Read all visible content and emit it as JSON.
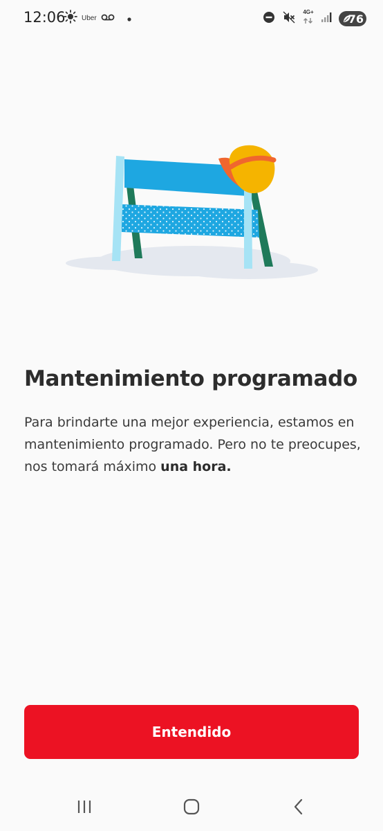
{
  "status_bar": {
    "time": "12:06",
    "uber_label": "Uber",
    "network_label": "4G+",
    "battery_level": "76",
    "icons": [
      "brightness-icon",
      "voicemail-icon",
      "dot-icon",
      "do-not-disturb-icon",
      "mute-icon",
      "signal-icon",
      "battery-icon"
    ]
  },
  "illustration": {
    "name": "barrier-with-hard-hat",
    "colors": {
      "board": "#1ea7e1",
      "legs_light": "#a6e3f5",
      "legs_dark": "#1f7a5a",
      "helmet": "#f5b400",
      "helmet_brim": "#f0662e",
      "shadow": "#e4e8ef"
    }
  },
  "content": {
    "title": "Mantenimiento programado",
    "description_plain": "Para brindarte una mejor experiencia, estamos en mantenimiento programado. Pero no te preocupes, nos tomará máximo ",
    "description_bold": "una hora."
  },
  "actions": {
    "primary_label": "Entendido",
    "primary_color": "#ec1223"
  },
  "navigation": {
    "icons": [
      "recent-apps-icon",
      "home-icon",
      "back-icon"
    ]
  }
}
